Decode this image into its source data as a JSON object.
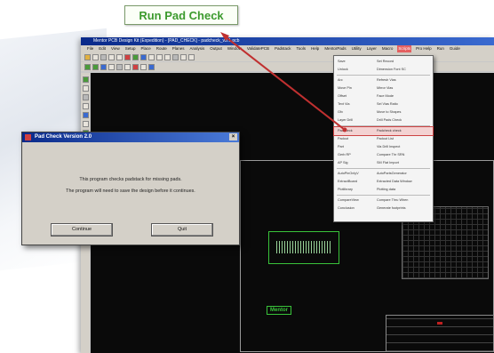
{
  "callout": {
    "label": "Run Pad Check"
  },
  "app": {
    "title": "Mentor PCB Design Kit (Expedition) - [PAD_CHECK] - padcheck_v3.1.pcb",
    "menus": [
      "File",
      "Edit",
      "View",
      "Setup",
      "Place",
      "Route",
      "Planes",
      "Analysis",
      "Output",
      "Window",
      "ValidatePCB",
      "Padstack",
      "Tools",
      "Help",
      "MentorPads",
      "Utility",
      "Layer",
      "Macro",
      "Scripts",
      "Pro Help",
      "Run",
      "Guide"
    ],
    "highlighted_menu_index": 18
  },
  "menu": {
    "items": [
      {
        "cmd": "Save",
        "desc": "Set Record"
      },
      {
        "cmd": "Unlock",
        "desc": "Dimension Font SC"
      },
      {
        "sep": true
      },
      {
        "cmd": "Arc",
        "desc": "Refresh Vias"
      },
      {
        "cmd": "Move Pin",
        "desc": "Mirror Vias"
      },
      {
        "cmd": "Offset",
        "desc": "Face Mode"
      },
      {
        "cmd": "Text Via",
        "desc": "Sel Vias Ratio"
      },
      {
        "cmd": "Gfx",
        "desc": "Move to Shapes"
      },
      {
        "cmd": "Layer Drill",
        "desc": "Drill Pads Check"
      },
      {
        "sep": true
      },
      {
        "cmd": "Padcheck",
        "desc": "Padcheck check",
        "selected": true
      },
      {
        "cmd": "Padout",
        "desc": "Padout List"
      },
      {
        "cmd": "Part",
        "desc": "Via Drill Inspect"
      },
      {
        "cmd": "Gerb RP",
        "desc": "Compare Thr SRN"
      },
      {
        "cmd": "AP Sig",
        "desc": "SM Flat Import"
      },
      {
        "sep": true
      },
      {
        "cmd": "AutoPinOnlyV",
        "desc": "AutoPartsGenerator"
      },
      {
        "cmd": "ExtractBoard",
        "desc": "Extracted Data Window"
      },
      {
        "cmd": "Plotlibrary",
        "desc": "Plotting data"
      },
      {
        "sep": true
      },
      {
        "cmd": "CompareView",
        "desc": "Compare Thru When"
      },
      {
        "cmd": "Conclusion",
        "desc": "Generate footprints"
      }
    ]
  },
  "dialog": {
    "title": "Pad Check Version 2.0",
    "message_line1": "This program checks padstack for missing pads.",
    "message_line2": "The program will need to save the design before it continues.",
    "continue_label": "Continue",
    "quit_label": "Quit"
  },
  "canvas": {
    "logo_text": "Mentor"
  },
  "colors": {
    "callout_text": "#3c9a2e",
    "arrow": "#c03030",
    "pcb_outline": "#39c33a"
  }
}
